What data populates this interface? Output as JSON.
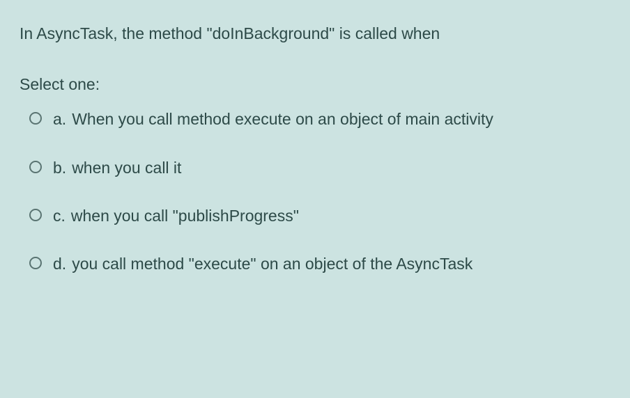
{
  "question": "In AsyncTask, the method \"doInBackground\" is called when",
  "prompt": "Select one:",
  "options": [
    {
      "letter": "a.",
      "text": "When you call method execute on an object of main activity"
    },
    {
      "letter": "b.",
      "text": "when you call it"
    },
    {
      "letter": "c.",
      "text": "when you call \"publishProgress\""
    },
    {
      "letter": "d.",
      "text": "you call method \"execute\" on an object of the AsyncTask"
    }
  ]
}
